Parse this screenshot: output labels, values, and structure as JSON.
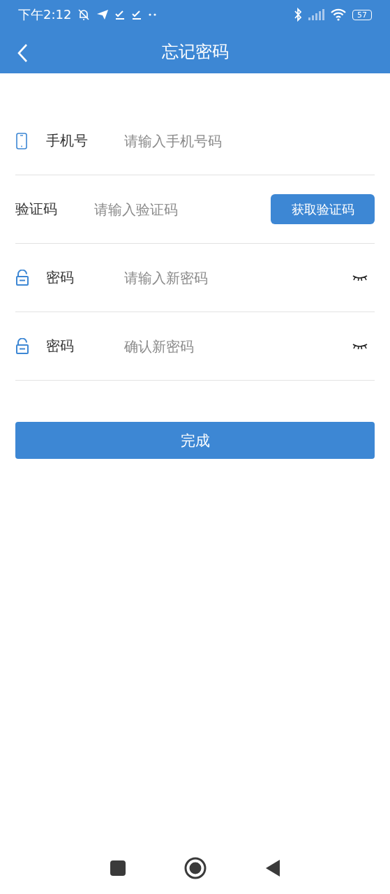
{
  "status_bar": {
    "time": "下午2:12",
    "battery": "57"
  },
  "header": {
    "title": "忘记密码"
  },
  "fields": [
    {
      "kind": "phone",
      "label": "手机号",
      "placeholder": "请输入手机号码"
    },
    {
      "kind": "code",
      "label": "验证码",
      "placeholder": "请输入验证码",
      "button": "获取验证码"
    },
    {
      "kind": "password",
      "label": "密码",
      "placeholder": "请输入新密码"
    },
    {
      "kind": "password",
      "label": "密码",
      "placeholder": "确认新密码"
    }
  ],
  "submit": "完成"
}
